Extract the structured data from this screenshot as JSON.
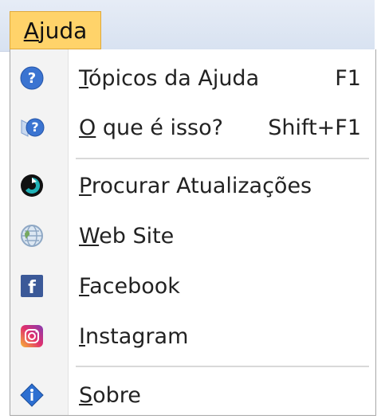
{
  "menubar": {
    "active_menu_label": "Ajuda",
    "mnemonic": "A",
    "rest": "juda"
  },
  "menu": {
    "items": [
      {
        "label": "Tópicos da Ajuda",
        "mnemonic": "T",
        "rest": "ópicos da Ajuda",
        "shortcut": "F1",
        "icon": "help-circle-icon"
      },
      {
        "label": "O que é isso?",
        "mnemonic": "O",
        "rest": " que é isso?",
        "shortcut": "Shift+F1",
        "icon": "whats-this-icon"
      },
      {
        "label": "Procurar Atualizações",
        "mnemonic": "P",
        "rest": "rocurar Atualizações",
        "shortcut": "",
        "icon": "update-icon"
      },
      {
        "label": "Web Site",
        "mnemonic": "W",
        "rest": "eb Site",
        "shortcut": "",
        "icon": "globe-icon"
      },
      {
        "label": "Facebook",
        "mnemonic": "F",
        "rest": "acebook",
        "shortcut": "",
        "icon": "facebook-icon"
      },
      {
        "label": "Instagram",
        "mnemonic": "I",
        "rest": "nstagram",
        "shortcut": "",
        "icon": "instagram-icon"
      },
      {
        "label": "Sobre",
        "mnemonic": "S",
        "rest": "obre",
        "shortcut": "",
        "icon": "info-icon"
      }
    ]
  },
  "colors": {
    "menubar_bg": "#dfe7f4",
    "active_menu_bg": "#ffd36a",
    "menu_text": "#222222",
    "blue_icon": "#3b74d1",
    "facebook_blue": "#3b5998"
  }
}
